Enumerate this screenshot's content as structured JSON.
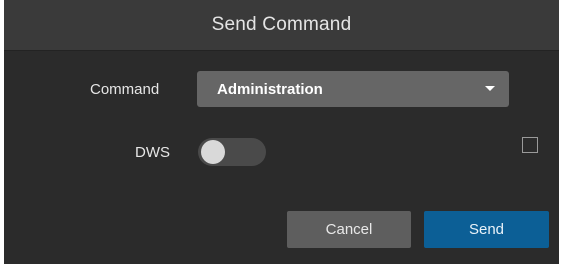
{
  "dialog": {
    "title": "Send Command"
  },
  "form": {
    "command_label": "Command",
    "command_value": "Administration",
    "dws_label": "DWS",
    "dws_enabled": false,
    "checkbox_checked": false
  },
  "footer": {
    "cancel_label": "Cancel",
    "send_label": "Send"
  },
  "colors": {
    "dialog_bg": "#2b2b2b",
    "header_bg": "#3a3a3a",
    "select_bg": "#666666",
    "cancel_bg": "#5e5e5e",
    "send_bg": "#0c5f96"
  },
  "icons": {
    "dropdown": "caret-down-icon"
  }
}
